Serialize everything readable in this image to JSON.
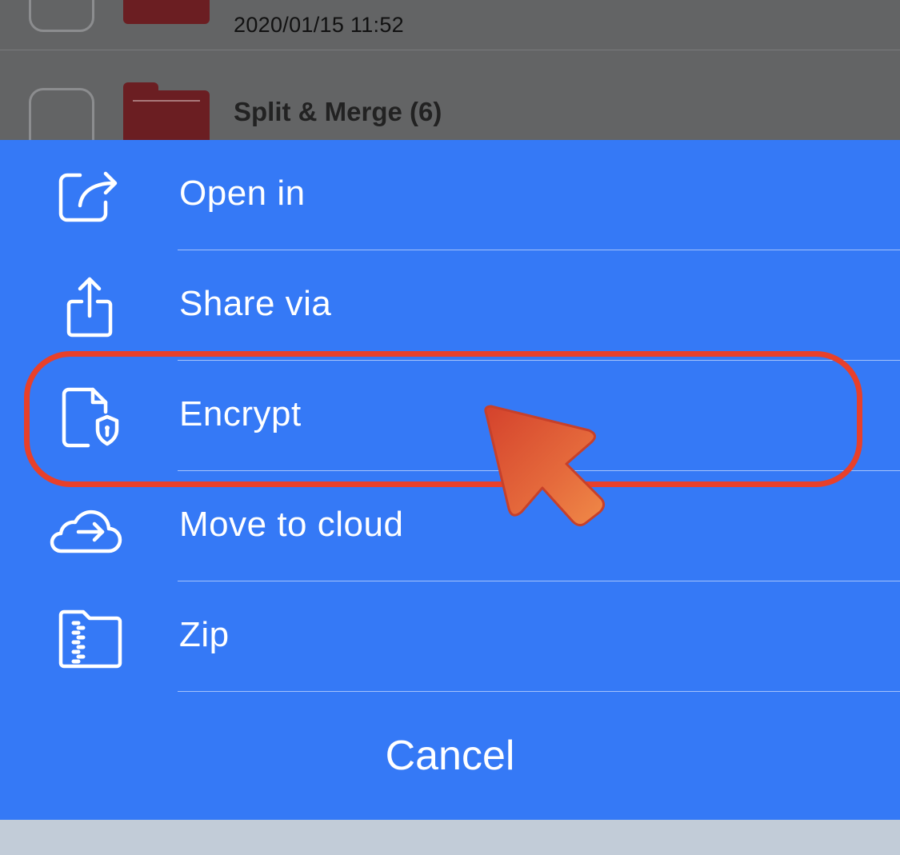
{
  "background_list": {
    "row1": {
      "date": "2020/01/15 11:52"
    },
    "row2": {
      "title": "Split & Merge (6)"
    }
  },
  "action_sheet": {
    "items": [
      {
        "label": "Open in",
        "icon": "open-in-icon"
      },
      {
        "label": "Share via",
        "icon": "share-icon"
      },
      {
        "label": "Encrypt",
        "icon": "encrypt-document-icon"
      },
      {
        "label": "Move to cloud",
        "icon": "cloud-upload-icon"
      },
      {
        "label": "Zip",
        "icon": "zip-folder-icon"
      }
    ],
    "cancel_label": "Cancel"
  },
  "colors": {
    "sheet_background": "#3579f6",
    "highlight": "#e8402a",
    "pointer": "#e0583a"
  },
  "annotation": {
    "highlighted_item": "Encrypt"
  }
}
